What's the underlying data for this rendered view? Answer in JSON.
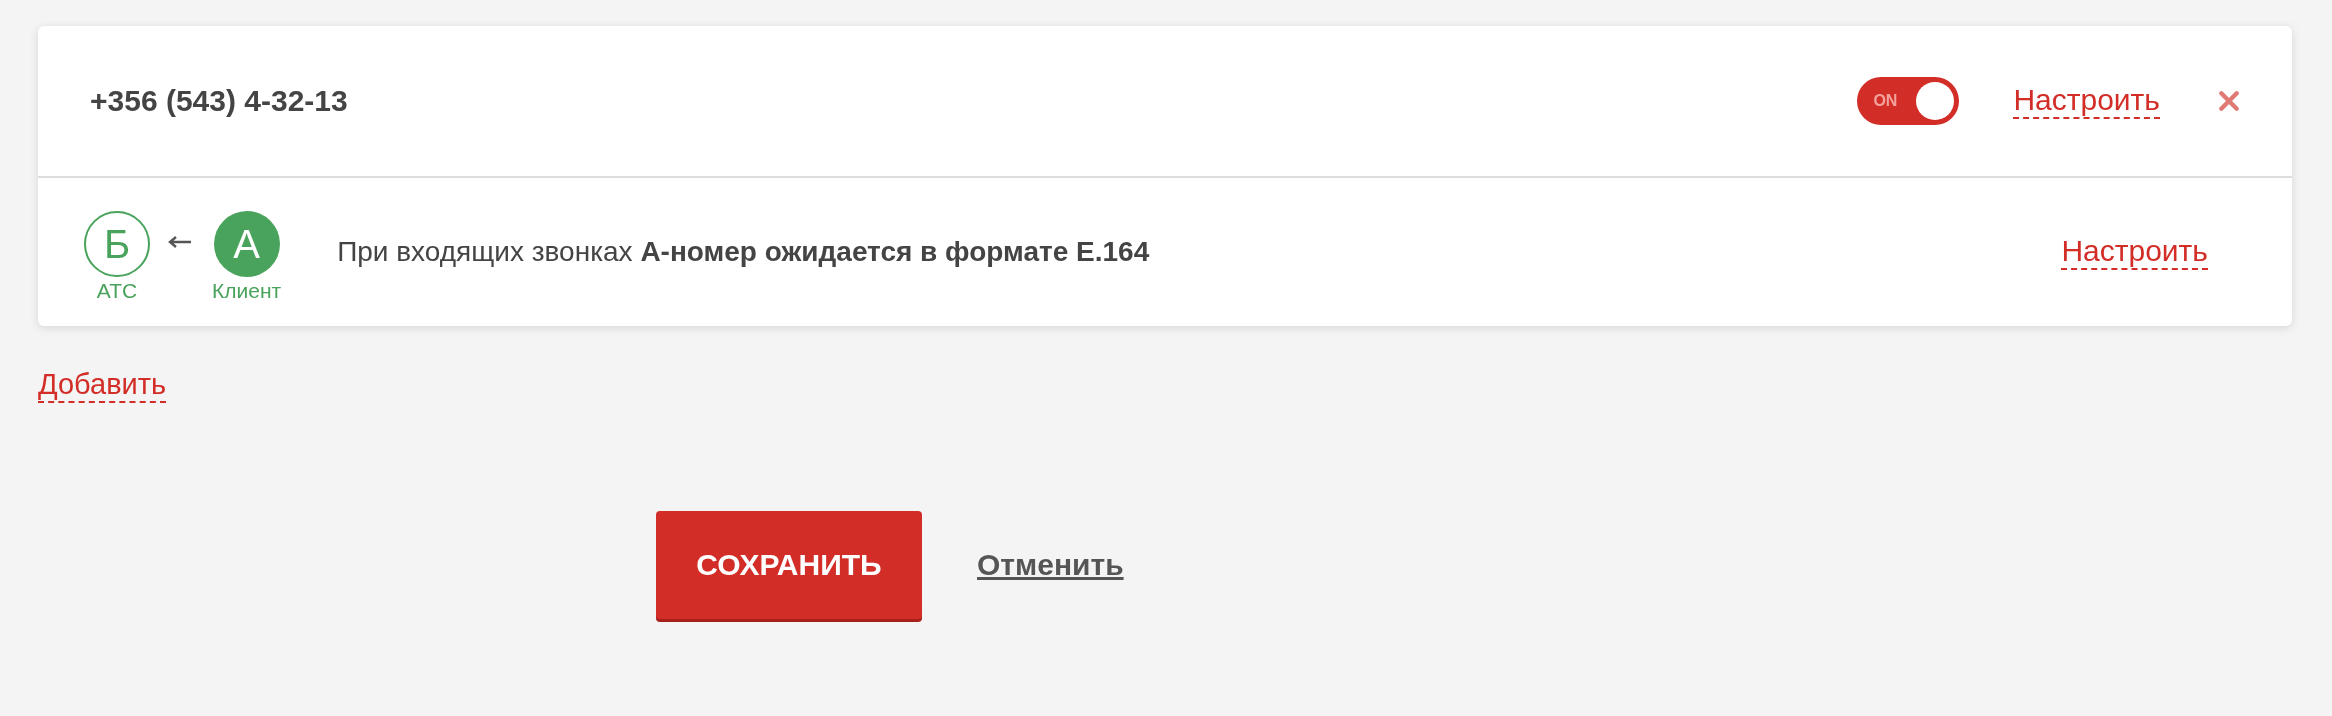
{
  "number_card": {
    "phone": "+356 (543) 4-32-13",
    "toggle": {
      "on": true,
      "label": "ON"
    },
    "configure_link": "Настроить",
    "format_row": {
      "badges": [
        {
          "letter": "Б",
          "caption": "АТС",
          "kind": "outline"
        },
        {
          "letter": "А",
          "caption": "Клиент",
          "kind": "filled"
        }
      ],
      "description": "При входящих звонках **А-номер ожидается в формате E.164**",
      "configure_link": "Настроить"
    }
  },
  "add_link": "Добавить",
  "buttons": {
    "save": "СОХРАНИТЬ",
    "cancel": "Отменить"
  }
}
